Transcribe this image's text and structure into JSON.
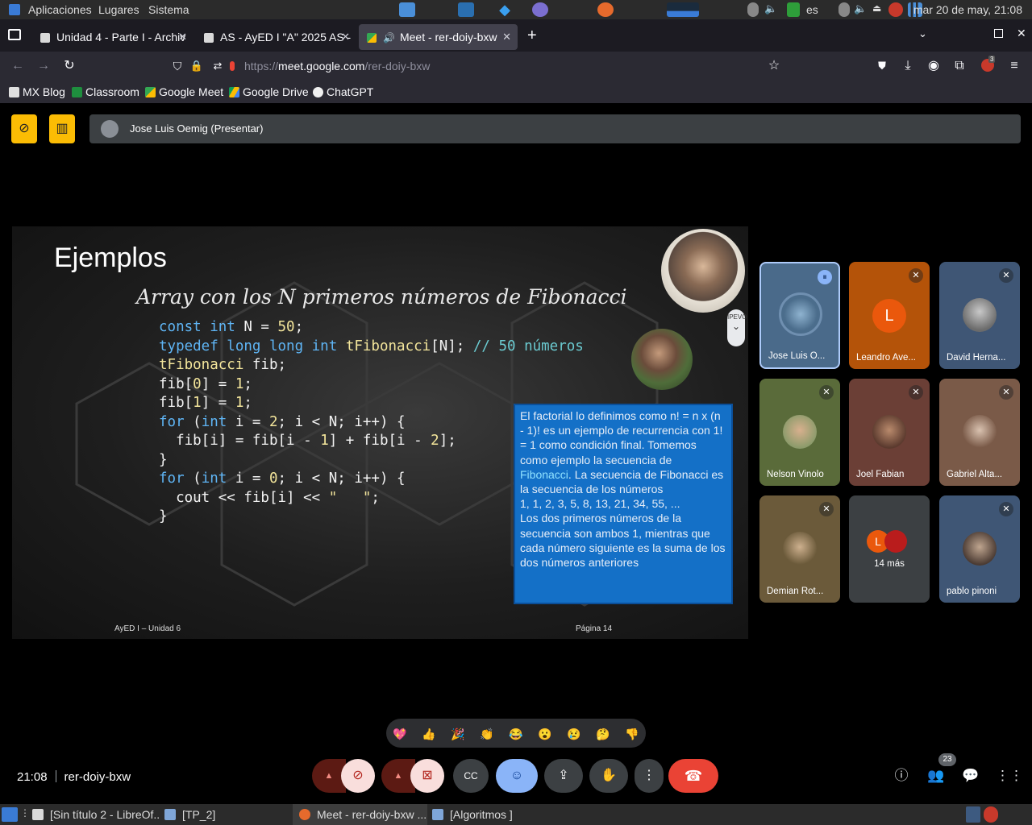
{
  "system_panel": {
    "menus": [
      "Aplicaciones",
      "Lugares",
      "Sistema"
    ],
    "keyboard_layout": "es",
    "clock": "mar 20 de may, 21:08"
  },
  "browser": {
    "tabs": [
      {
        "label": "Unidad 4 - Parte I - Archiv",
        "active": false
      },
      {
        "label": "AS - AyED I \"A\" 2025 AS -",
        "active": false
      },
      {
        "label": "Meet - rer-doiy-bxw",
        "active": true
      }
    ],
    "url_prefix": "https://",
    "url_host": "meet.google.com",
    "url_path": "/rer-doiy-bxw",
    "bookmarks": [
      "MX Blog",
      "Classroom",
      "Google Meet",
      "Google Drive",
      "ChatGPT"
    ],
    "extension_badge": "3"
  },
  "meet": {
    "presenter_label": "Jose Luis Oemig (Presentar)",
    "slide": {
      "title": "Ejemplos",
      "subtitle": "Array con los N primeros números de Fibonacci",
      "footer_left": "AyED I – Unidad 6",
      "footer_right": "Página 14",
      "widget_label": "IPEVO",
      "info_box": {
        "text_before": "El factorial lo definimos como n! = n x (n - 1)! es un ejemplo de recurrencia con 1! = 1 como condición final. Tomemos como ejemplo la secuencia de ",
        "highlight": "Fibonacci",
        "text_after": ". La secuencia de Fibonacci es la secuencia de los números",
        "sequence": " 1, 1, 2, 3, 5, 8, 13, 21, 34, 55, ...",
        "closing": "Los dos primeros números de la secuencia son ambos 1, mientras que cada número siguiente es la suma de los dos números anteriores"
      }
    },
    "participants": [
      {
        "name": "Jose Luis O...",
        "speaking": true
      },
      {
        "name": "Leandro Ave...",
        "initial": "L",
        "muted": true
      },
      {
        "name": "David Herna...",
        "muted": true
      },
      {
        "name": "Nelson Vinolo",
        "muted": true
      },
      {
        "name": "Joel Fabian",
        "muted": true
      },
      {
        "name": "Gabriel Alta...",
        "muted": true
      },
      {
        "name": "Demian Rot...",
        "muted": true
      },
      {
        "name": "14 más",
        "initial": "L"
      },
      {
        "name": "pablo pinoni",
        "muted": true
      }
    ],
    "reactions": [
      "💖",
      "👍",
      "🎉",
      "👏",
      "😂",
      "😮",
      "😢",
      "🤔",
      "👎"
    ],
    "time": "21:08",
    "meeting_code": "rer-doiy-bxw",
    "people_count": "23"
  },
  "taskbar": {
    "items": [
      {
        "label": "[Sin título 2 - LibreOf...",
        "active": false
      },
      {
        "label": "[TP_2]",
        "active": false
      },
      {
        "label": "Meet - rer-doiy-bxw ...",
        "active": true
      },
      {
        "label": "[Algoritmos ]",
        "active": false
      }
    ]
  },
  "colors": {
    "meet_yellow": "#fbbc04",
    "hangup_red": "#ea4335",
    "mic_off_pink": "#f9dedc",
    "reaction_blue": "#8ab4f8",
    "code_keyword": "#5fb5f5",
    "code_number": "#f3e59b",
    "info_box_blue": "#1470c7"
  }
}
